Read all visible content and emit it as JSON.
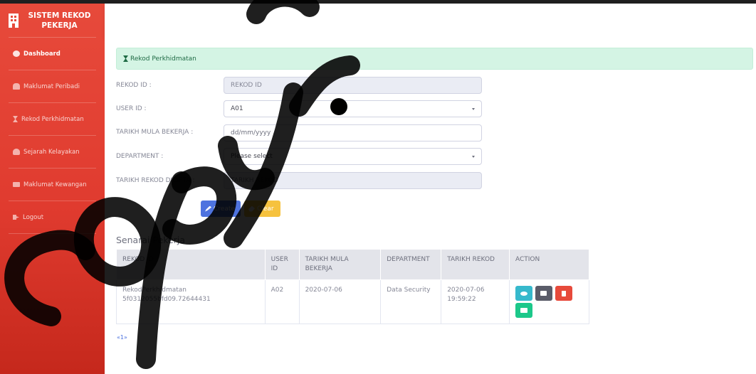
{
  "app": {
    "brand_title": "SISTEM REKOD PEKERJA",
    "brand_icon": "building-icon"
  },
  "sidebar": {
    "items": [
      {
        "label": "Dashboard",
        "icon": "dashboard-icon",
        "active": true
      },
      {
        "label": "Maklumat Peribadi",
        "icon": "users-icon"
      },
      {
        "label": "Rekod Perkhidmatan",
        "icon": "hourglass-icon"
      },
      {
        "label": "Sejarah Kelayakan",
        "icon": "user-icon"
      },
      {
        "label": "Maklumat Kewangan",
        "icon": "money-icon"
      },
      {
        "label": "Logout",
        "icon": "logout-icon"
      }
    ]
  },
  "alert": {
    "text": "Rekod Perkhidmatan",
    "icon": "hourglass-icon"
  },
  "form": {
    "rekod_id": {
      "label": "REKOD ID :",
      "placeholder": "REKOD ID"
    },
    "user_id": {
      "label": "USER ID :",
      "value": "A01"
    },
    "tarikh_mula": {
      "label": "TARIKH MULA BEKERJA :",
      "placeholder": "dd/mm/yyyy"
    },
    "department": {
      "label": "DEPARTMENT :",
      "value": "Please select"
    },
    "tarikh_rekod": {
      "label": "TARIKH REKOD DICIPTA :",
      "placeholder": "TARIKH REKOD"
    },
    "create_label": "Create",
    "clear_label": "Clear"
  },
  "list": {
    "title": "Senarai Pekerja",
    "columns": [
      "REKOD ID",
      "USER ID",
      "TARIKH MULA BEKERJA",
      "DEPARTMENT",
      "TARIKH REKOD",
      "ACTION"
    ],
    "rows": [
      {
        "rekod_id": "RekodPerkhidmatan 5f0312055bfd09.72644431",
        "user_id": "A02",
        "tarikh_mula": "2020-07-06",
        "department": "Data Security",
        "tarikh_rekod": "2020-07-06 19:59:22"
      }
    ]
  },
  "pagination": {
    "text": "«1»"
  },
  "watermark": {
    "text": "copyright",
    "color": "#000000"
  },
  "colors": {
    "sidebar": "#e74a3b",
    "primary": "#4e73df",
    "warning": "#f6c23e",
    "info": "#36b9cc",
    "danger": "#e74a3b",
    "success": "#1cc88a",
    "dark": "#5a5c69"
  }
}
